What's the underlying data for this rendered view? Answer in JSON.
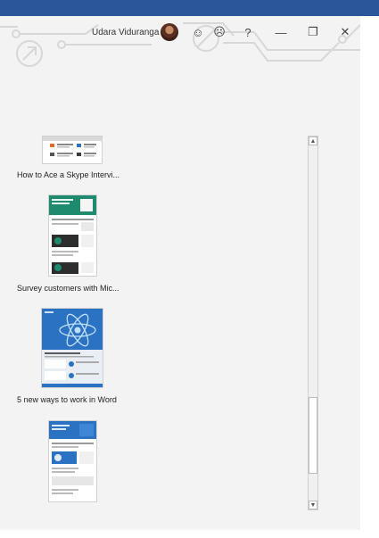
{
  "user": {
    "name": "Udara Viduranga"
  },
  "titlebar": {
    "smile_glyph": "☺",
    "frown_glyph": "☹",
    "help_glyph": "?",
    "minimize_glyph": "—",
    "restore_glyph": "❐",
    "close_glyph": "✕"
  },
  "templates": [
    {
      "label": "How to Ace a Skype Intervi..."
    },
    {
      "label": "Survey customers with Mic..."
    },
    {
      "label": "5 new ways to work in Word"
    },
    {
      "label": ""
    }
  ],
  "scroll": {
    "up_glyph": "▲",
    "down_glyph": "▼",
    "position": 0.9
  },
  "colors": {
    "accent": "#2b579a",
    "teal": "#1e8a6e",
    "word_blue": "#2b72c2"
  }
}
